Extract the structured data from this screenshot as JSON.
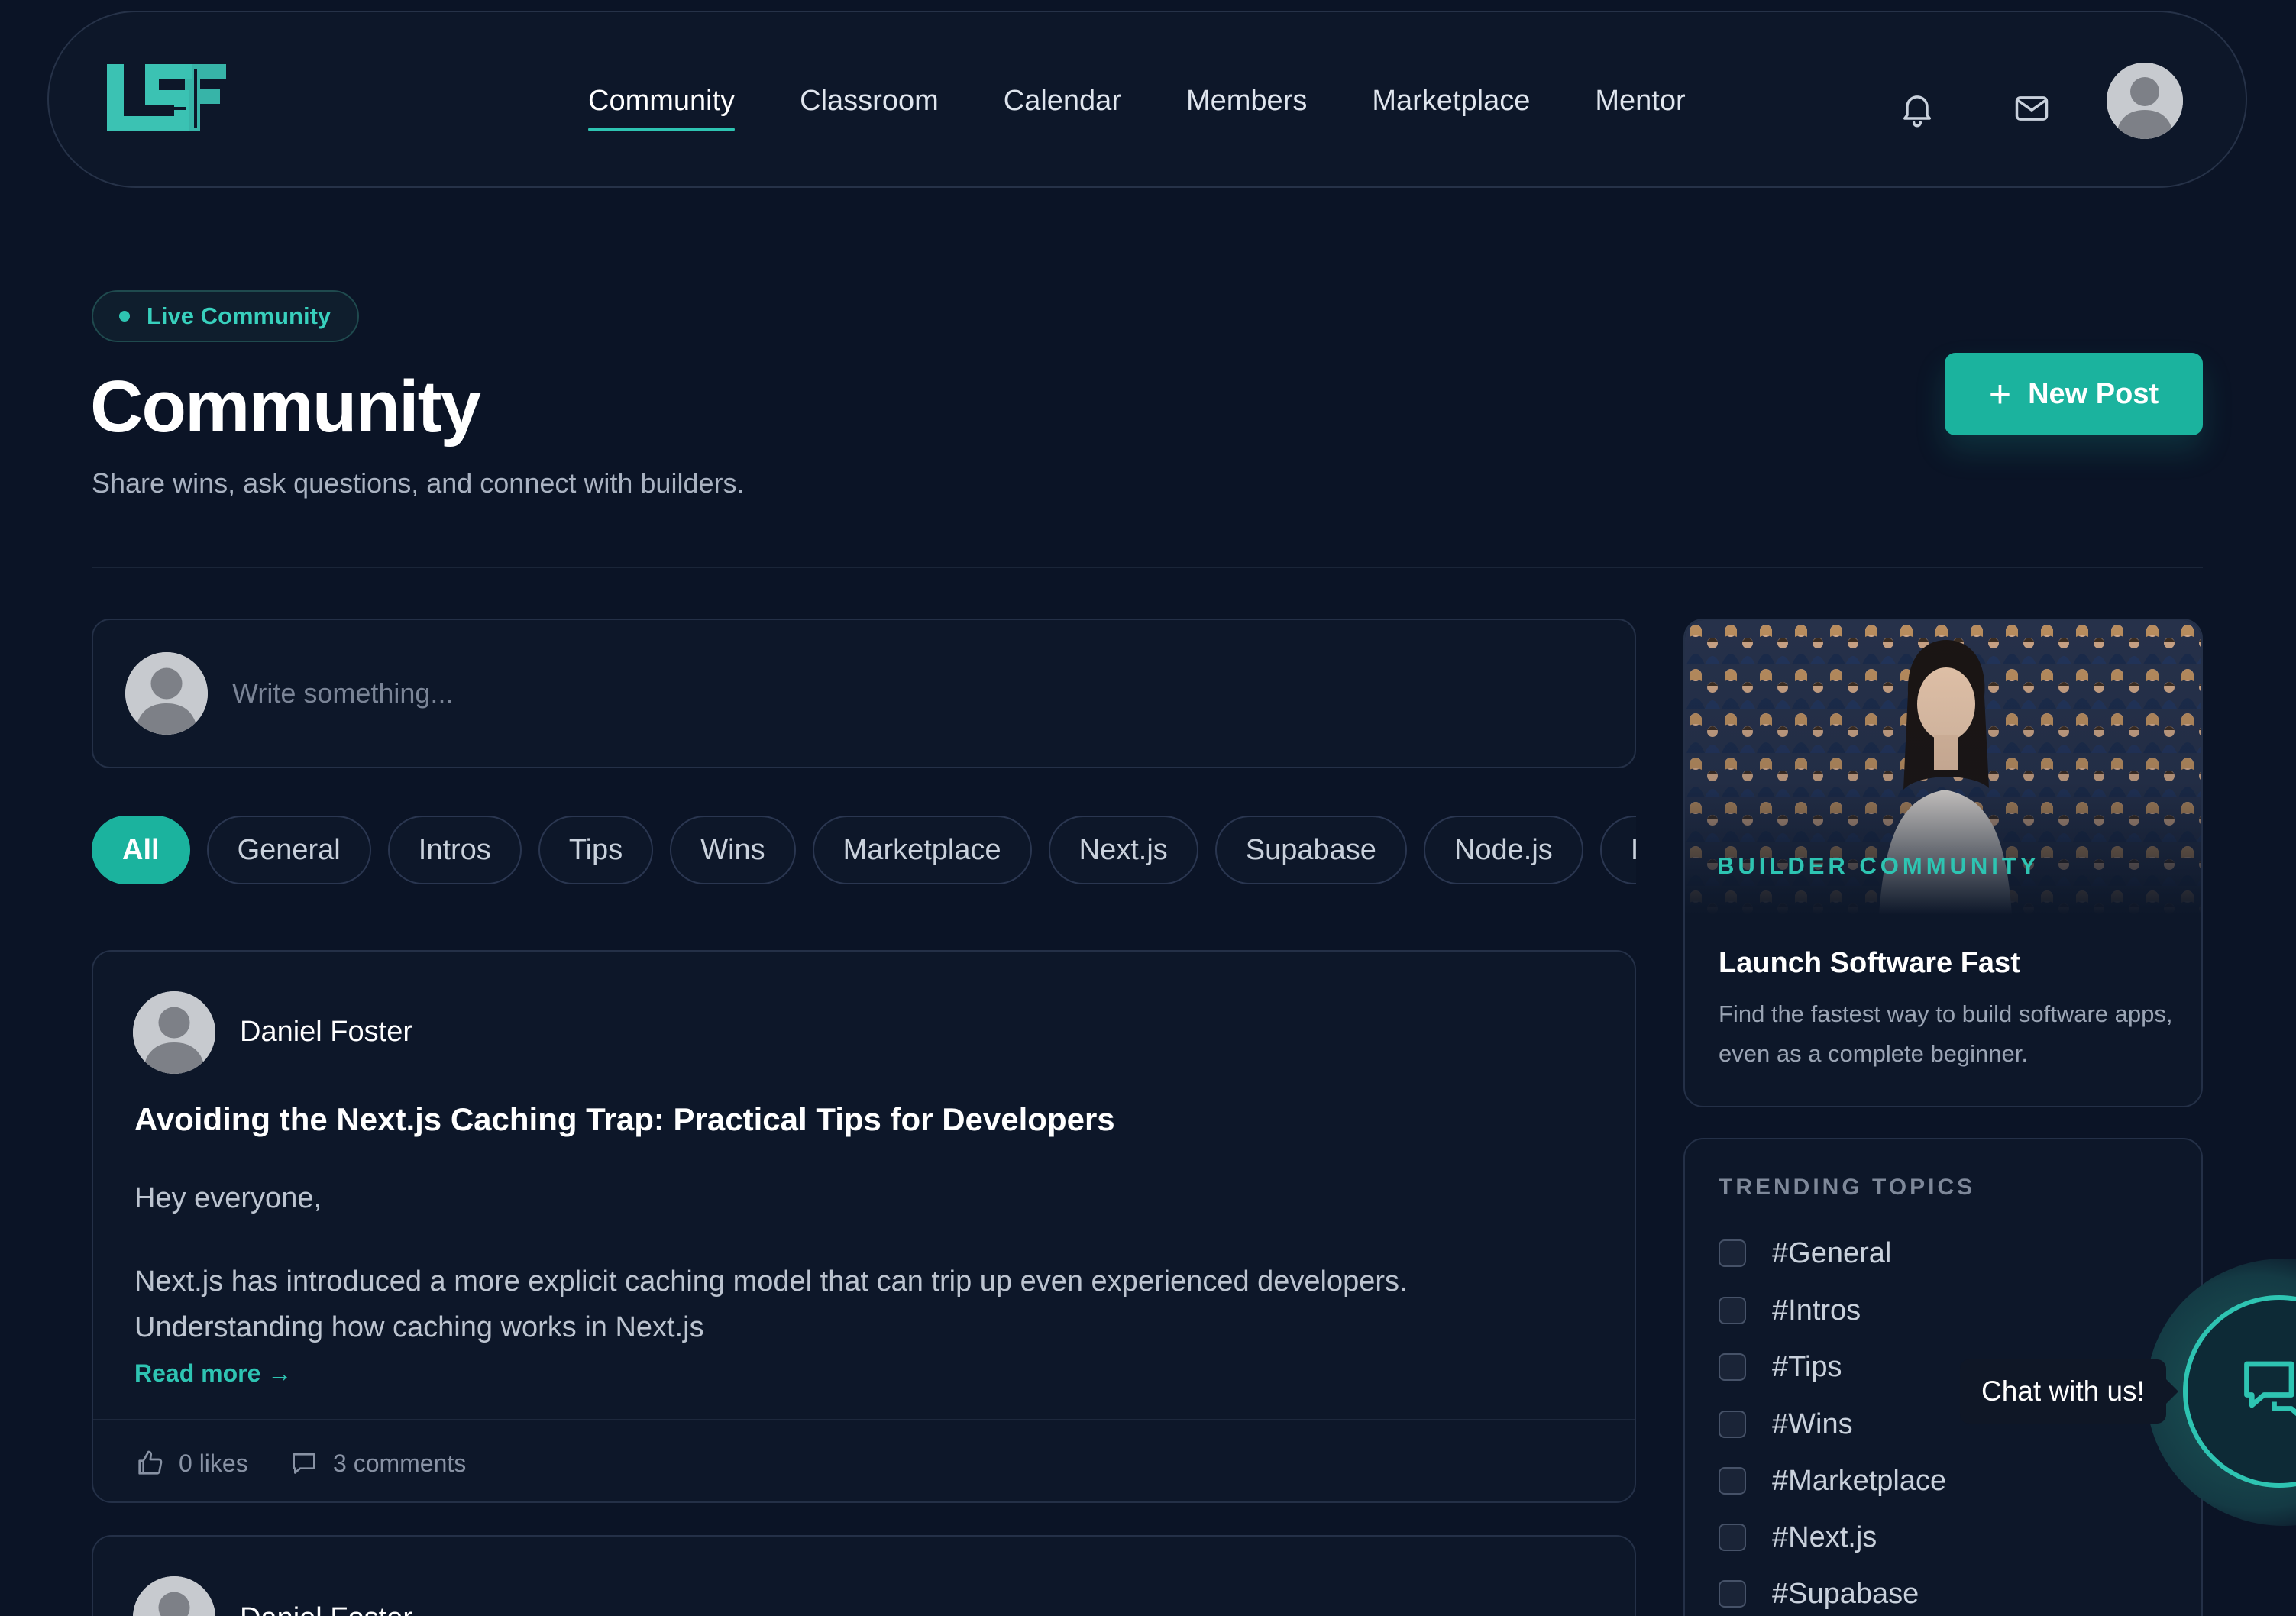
{
  "brand": {
    "accent": "#1bb39e",
    "accent_light": "#2ec4b2",
    "background": "#0b1426",
    "card": "#0d1729"
  },
  "nav": {
    "logo_text": "LSF",
    "links": [
      {
        "label": "Community",
        "active": true
      },
      {
        "label": "Classroom",
        "active": false
      },
      {
        "label": "Calendar",
        "active": false
      },
      {
        "label": "Members",
        "active": false
      },
      {
        "label": "Marketplace",
        "active": false
      },
      {
        "label": "Mentor",
        "active": false
      }
    ],
    "icons": [
      "bell-icon",
      "mail-icon",
      "avatar"
    ]
  },
  "header": {
    "badge": "Live Community",
    "title": "Community",
    "subtitle": "Share wins, ask questions, and connect with builders.",
    "new_post_label": "New Post"
  },
  "composer": {
    "placeholder": "Write something..."
  },
  "filters": {
    "chips": [
      "All",
      "General",
      "Intros",
      "Tips",
      "Wins",
      "Marketplace",
      "Next.js",
      "Supabase",
      "Node.js",
      "I"
    ],
    "active": "All"
  },
  "posts": [
    {
      "author": "Daniel Foster",
      "title": "Avoiding the Next.js Caching Trap: Practical Tips for Developers",
      "greeting": "Hey everyone,",
      "excerpt": "Next.js has introduced a more explicit caching model that can trip up even experienced developers. Understanding how caching works in Next.js",
      "read_more": "Read more →",
      "likes": "0 likes",
      "comments": "3 comments"
    },
    {
      "author": "Daniel Foster"
    }
  ],
  "promo": {
    "kicker": "BUILDER COMMUNITY",
    "title": "Launch Software Fast",
    "description": "Find the fastest way to build software apps, even as a complete beginner."
  },
  "trending": {
    "heading": "TRENDING TOPICS",
    "topics": [
      "#General",
      "#Intros",
      "#Tips",
      "#Wins",
      "#Marketplace",
      "#Next.js",
      "#Supabase"
    ]
  },
  "chat": {
    "label": "Chat with us!"
  }
}
